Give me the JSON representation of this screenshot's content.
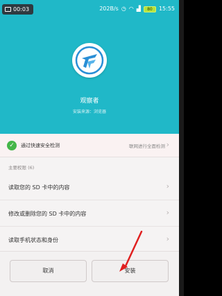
{
  "status_bar": {
    "recording_time": "00:03",
    "network_speed": "202B/s",
    "battery_level": "80",
    "clock": "15:55"
  },
  "app": {
    "name": "观察者",
    "source": "安装来源：浏览器"
  },
  "security": {
    "status_text": "通过快速安全检测",
    "action_text": "联网进行全面检测"
  },
  "permissions": {
    "section_label": "主要权限 (6)",
    "items": [
      "读取您的 SD 卡中的内容",
      "修改或删除您的 SD 卡中的内容",
      "读取手机状态和身份"
    ]
  },
  "buttons": {
    "cancel": "取消",
    "install": "安装"
  },
  "colors": {
    "header_bg": "#20b8c8",
    "success": "#45b649",
    "annotation": "#e02020"
  },
  "icons": {
    "app": "app-logo-icon",
    "check": "check-circle-icon",
    "chevron": "chevron-right-icon"
  }
}
